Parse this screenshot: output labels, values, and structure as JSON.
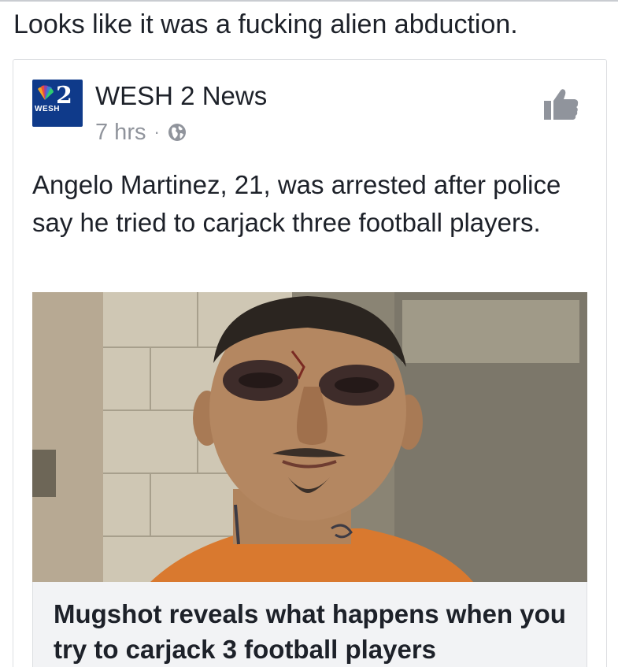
{
  "post": {
    "text": "Looks like it was a fucking alien abduction."
  },
  "shared": {
    "page_name": "WESH 2 News",
    "timestamp": "7 hrs",
    "separator": "·",
    "logo": {
      "number": "2",
      "call_letters": "WESH",
      "bg": "#0f3a8a"
    },
    "body": "Angelo Martinez, 21, was arrested after police say he tried to carjack three football players.",
    "link": {
      "image_icon": "mugshot-photo",
      "title": "Mugshot reveals what happens when you try to carjack 3 football players"
    },
    "icons": [
      "globe-icon",
      "like-icon"
    ]
  },
  "colors": {
    "text": "#1d2129",
    "meta": "#90949c",
    "caption_bg": "#f2f3f5",
    "border": "#dddfe2"
  }
}
